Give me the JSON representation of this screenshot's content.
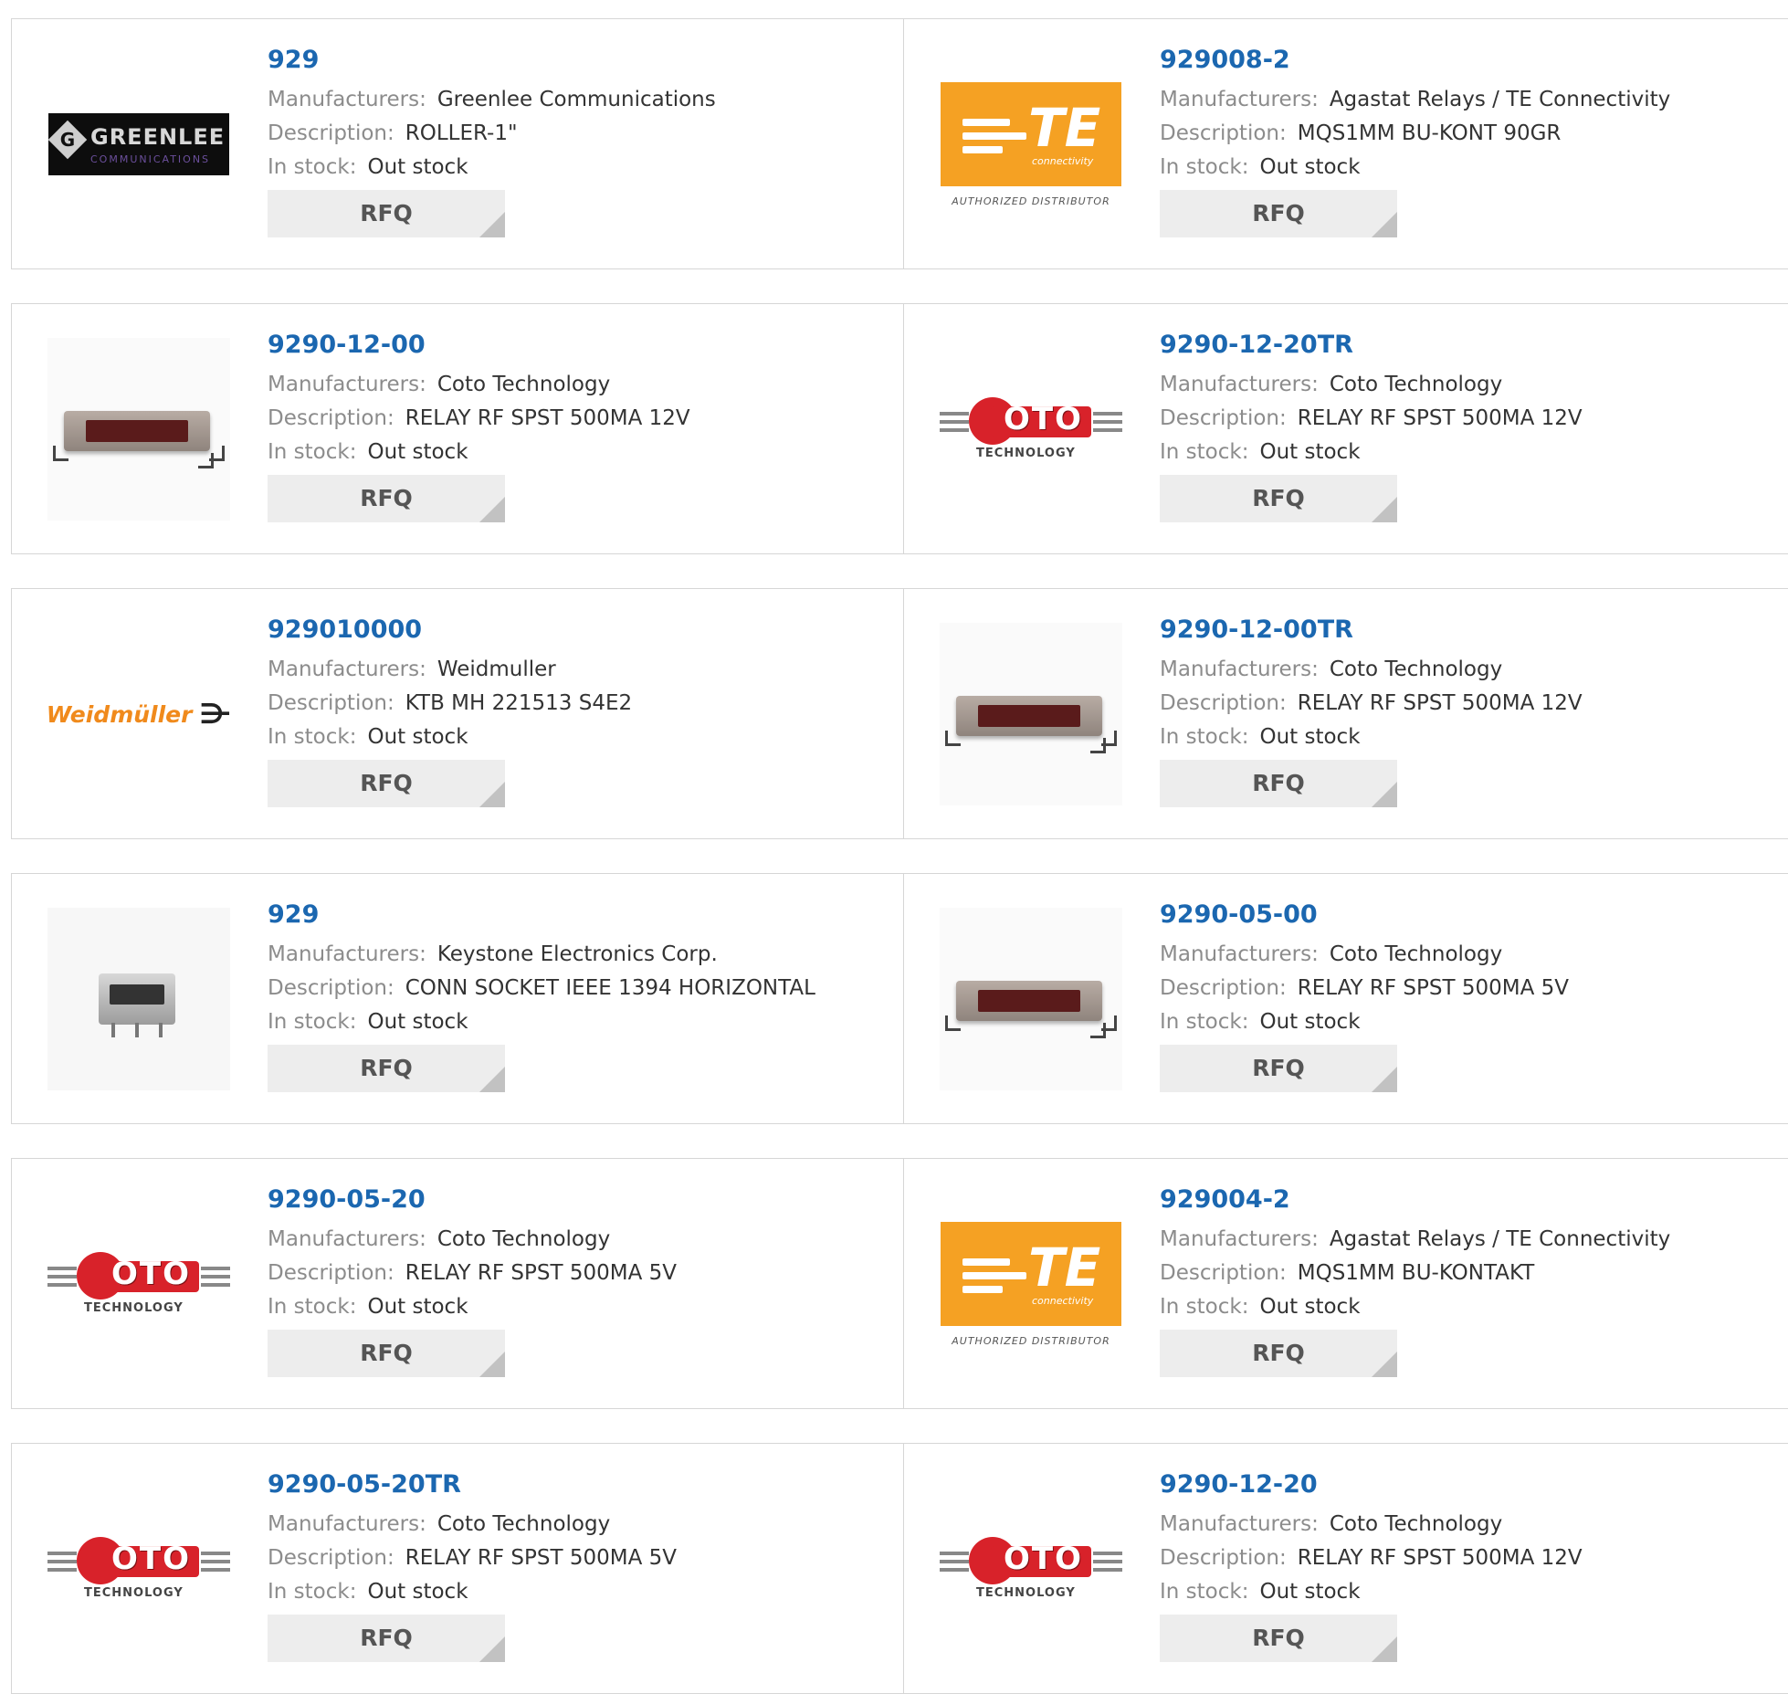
{
  "labels": {
    "manufacturers": "Manufacturers:",
    "description": "Description:",
    "in_stock": "In stock:",
    "rfq": "RFQ"
  },
  "colors": {
    "part_link": "#1b67b0",
    "label_gray": "#8c8c8c",
    "rfq_bg": "#ededed",
    "te_orange": "#f5a123",
    "coto_red": "#d8222a",
    "weidmuller_orange": "#f08a1c"
  },
  "logo_text": {
    "greenlee": "GREENLEE",
    "greenlee_sub": "COMMUNICATIONS",
    "te": "TE",
    "te_sub": "connectivity",
    "te_authorized": "AUTHORIZED DISTRIBUTOR",
    "coto": "OTO",
    "coto_tech": "TECHNOLOGY",
    "weidmuller": "Weidmüller"
  },
  "products": [
    {
      "part": "929",
      "manufacturer": "Greenlee Communications",
      "description": "ROLLER-1\"",
      "stock": "Out stock",
      "image": "greenlee-logo"
    },
    {
      "part": "929008-2",
      "manufacturer": "Agastat Relays / TE Connectivity",
      "description": "MQS1MM BU-KONT 90GR",
      "stock": "Out stock",
      "image": "te-logo"
    },
    {
      "part": "9290-12-00",
      "manufacturer": "Coto Technology",
      "description": "RELAY RF SPST 500MA 12V",
      "stock": "Out stock",
      "image": "relay-photo"
    },
    {
      "part": "9290-12-20TR",
      "manufacturer": "Coto Technology",
      "description": "RELAY RF SPST 500MA 12V",
      "stock": "Out stock",
      "image": "coto-logo"
    },
    {
      "part": "929010000",
      "manufacturer": "Weidmuller",
      "description": "KTB MH 221513 S4E2",
      "stock": "Out stock",
      "image": "weidmuller-logo"
    },
    {
      "part": "9290-12-00TR",
      "manufacturer": "Coto Technology",
      "description": "RELAY RF SPST 500MA 12V",
      "stock": "Out stock",
      "image": "relay-photo"
    },
    {
      "part": "929",
      "manufacturer": "Keystone Electronics Corp.",
      "description": "CONN SOCKET IEEE 1394 HORIZONTAL",
      "stock": "Out stock",
      "image": "connector-photo"
    },
    {
      "part": "9290-05-00",
      "manufacturer": "Coto Technology",
      "description": "RELAY RF SPST 500MA 5V",
      "stock": "Out stock",
      "image": "relay-photo"
    },
    {
      "part": "9290-05-20",
      "manufacturer": "Coto Technology",
      "description": "RELAY RF SPST 500MA 5V",
      "stock": "Out stock",
      "image": "coto-logo"
    },
    {
      "part": "929004-2",
      "manufacturer": "Agastat Relays / TE Connectivity",
      "description": "MQS1MM BU-KONTAKT",
      "stock": "Out stock",
      "image": "te-logo"
    },
    {
      "part": "9290-05-20TR",
      "manufacturer": "Coto Technology",
      "description": "RELAY RF SPST 500MA 5V",
      "stock": "Out stock",
      "image": "coto-logo"
    },
    {
      "part": "9290-12-20",
      "manufacturer": "Coto Technology",
      "description": "RELAY RF SPST 500MA 12V",
      "stock": "Out stock",
      "image": "coto-logo"
    }
  ]
}
